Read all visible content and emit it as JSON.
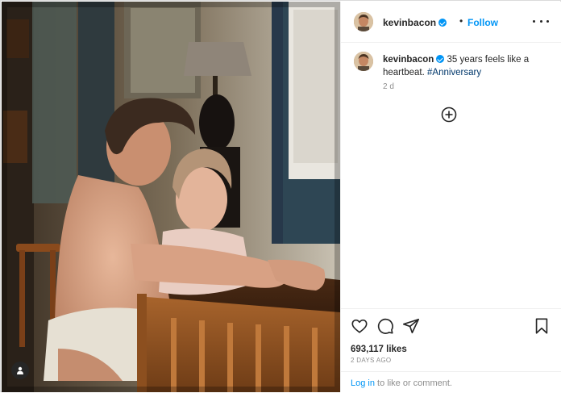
{
  "post": {
    "username": "kevinbacon",
    "follow_label": "Follow",
    "separator": "•",
    "caption": {
      "text": "35 years feels like a heartbeat.",
      "hashtag": "#Anniversary",
      "relative_time": "2 d"
    },
    "likes_count": "693,117",
    "likes_suffix": "likes",
    "posted_ago": "2 DAYS AGO",
    "login_prompt": {
      "link": "Log in",
      "rest": "to like or comment."
    }
  },
  "icons": {
    "verified": "verified-badge-icon",
    "more": "more-options-icon",
    "add_comment": "add-circle-icon",
    "like": "heart-icon",
    "comment": "comment-icon",
    "share": "share-icon",
    "save": "bookmark-icon",
    "user_tag": "user-tag-icon"
  },
  "colors": {
    "accent": "#0095f6",
    "hashtag": "#00376b",
    "text": "#262626",
    "secondary": "#8e8e8e"
  }
}
